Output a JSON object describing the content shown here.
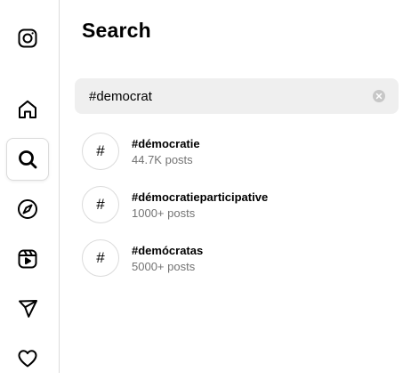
{
  "sidebar": {
    "items": [
      {
        "name": "instagram-logo-icon"
      },
      {
        "name": "home-icon"
      },
      {
        "name": "search-icon",
        "active": true
      },
      {
        "name": "explore-compass-icon"
      },
      {
        "name": "reels-icon"
      },
      {
        "name": "messages-send-icon"
      },
      {
        "name": "notifications-heart-icon"
      }
    ]
  },
  "search_panel": {
    "title": "Search",
    "query": "#democrat",
    "results": [
      {
        "name": "#démocratie",
        "count": "44.7K posts",
        "icon": "#"
      },
      {
        "name": "#démocratieparticipative",
        "count": "1000+ posts",
        "icon": "#"
      },
      {
        "name": "#demócratas",
        "count": "5000+ posts",
        "icon": "#"
      }
    ]
  },
  "colors": {
    "border": "#dbdbdb",
    "search_bg": "#efefef",
    "secondary_text": "#737373",
    "clear_button": "#c7c7c7"
  }
}
